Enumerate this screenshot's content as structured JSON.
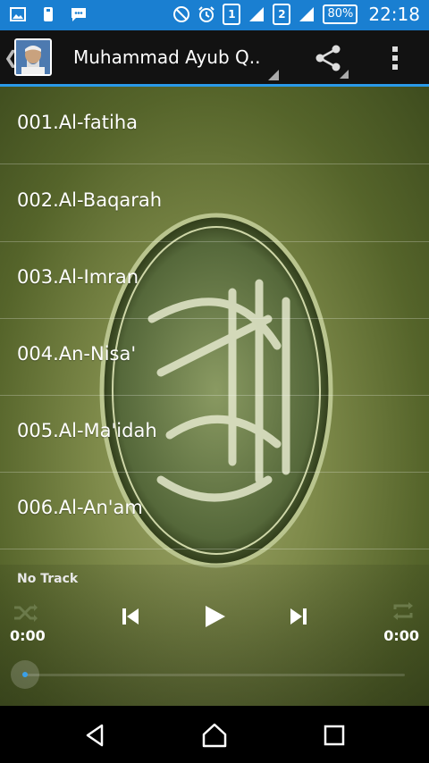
{
  "status_bar": {
    "sim1": "1",
    "sim2": "2",
    "battery": "80%",
    "time": "22:18",
    "color": "#1a7fd1"
  },
  "app_bar": {
    "title": "Muhammad Ayub Q..",
    "accent": "#2a9ae8"
  },
  "tracks": [
    {
      "label": "001.Al-fatiha"
    },
    {
      "label": "002.Al-Baqarah"
    },
    {
      "label": "003.Al-Imran"
    },
    {
      "label": "004.An-Nisa'"
    },
    {
      "label": "005.Al-Ma'idah"
    },
    {
      "label": "006.Al-An'am"
    }
  ],
  "player": {
    "now_playing": "No Track",
    "elapsed": "0:00",
    "duration": "0:00",
    "progress": 0
  }
}
